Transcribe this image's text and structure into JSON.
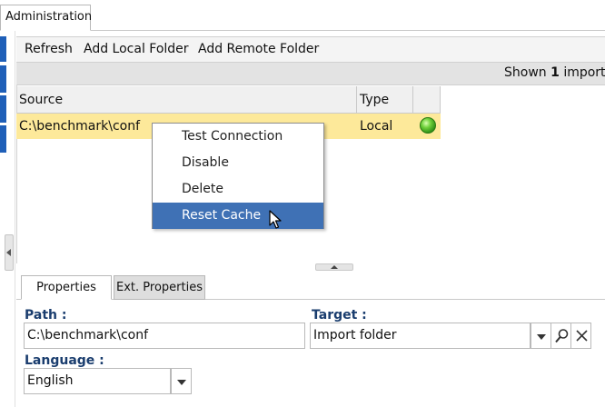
{
  "top_tab": {
    "label": "Administration"
  },
  "toolbar": {
    "refresh_label": "Refresh",
    "add_local_label": "Add Local Folder",
    "add_remote_label": "Add Remote Folder"
  },
  "status": {
    "shown_prefix": "Shown",
    "shown_count": "1",
    "shown_suffix": "import"
  },
  "grid": {
    "columns": [
      "Source",
      "Type",
      ""
    ],
    "rows": [
      {
        "source": "C:\\benchmark\\conf",
        "type": "Local",
        "status_icon": "green-status-icon"
      }
    ]
  },
  "context_menu": {
    "items": [
      "Test Connection",
      "Disable",
      "Delete",
      "Reset Cache"
    ],
    "highlighted": "Reset Cache"
  },
  "tabs": [
    "Properties",
    "Ext. Properties"
  ],
  "form": {
    "path_label": "Path :",
    "path_value": "C:\\benchmark\\conf",
    "target_label": "Target :",
    "target_value": "Import folder",
    "language_label": "Language :",
    "language_value": "English"
  },
  "colors": {
    "selected_row": "#fde99a",
    "menu_highlight": "#3f71b5",
    "sidebar_blue": "#1f5fb8",
    "label_blue": "#1a3d6e"
  }
}
